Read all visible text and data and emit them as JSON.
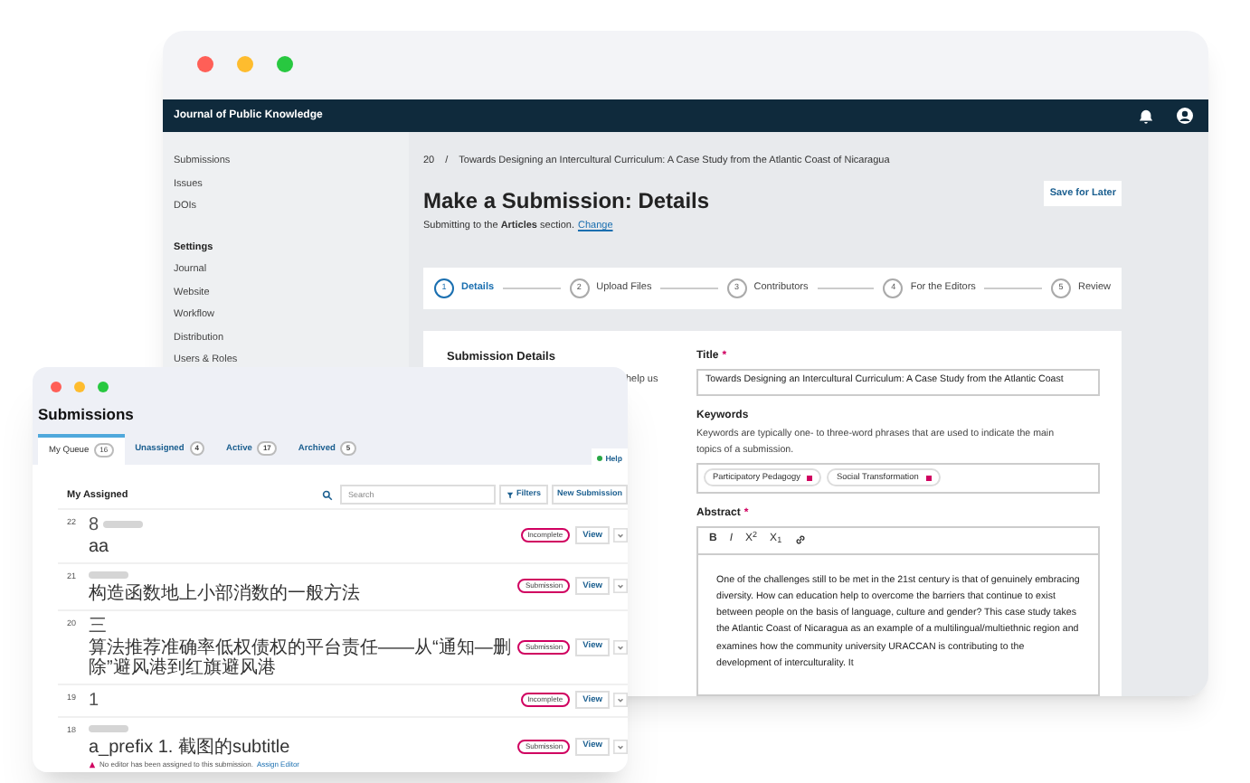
{
  "main_window": {
    "header": {
      "title": "Journal of Public Knowledge"
    },
    "sidebar": {
      "items": [
        {
          "label": "Submissions",
          "kind": "link"
        },
        {
          "label": "Issues",
          "kind": "link"
        },
        {
          "label": "DOIs",
          "kind": "link"
        },
        {
          "label": "Settings",
          "kind": "heading"
        },
        {
          "label": "Journal",
          "kind": "link"
        },
        {
          "label": "Website",
          "kind": "link"
        },
        {
          "label": "Workflow",
          "kind": "link"
        },
        {
          "label": "Distribution",
          "kind": "link"
        },
        {
          "label": "Users & Roles",
          "kind": "link"
        }
      ]
    },
    "breadcrumb": {
      "number": "20",
      "separator": "/",
      "title": "Towards Designing an Intercultural Curriculum: A Case Study from the Atlantic Coast of Nicaragua"
    },
    "page_title": "Make a Submission: Details",
    "subtitle": "Submitting to the **Articles** section.",
    "change_link": "Change",
    "save_button": "Save for Later",
    "steps": [
      {
        "number": "1",
        "label": "Details",
        "selected": true
      },
      {
        "number": "2",
        "label": "Upload Files",
        "selected": false
      },
      {
        "number": "3",
        "label": "Contributors",
        "selected": false
      },
      {
        "number": "4",
        "label": "For the Editors",
        "selected": false
      },
      {
        "number": "5",
        "label": "Review",
        "selected": false
      }
    ],
    "section": {
      "title": "Submission Details",
      "description_fragment": "help us"
    },
    "form": {
      "required_mark": "*",
      "title_label": "Title",
      "title_value": "Towards Designing an Intercultural Curriculum: A Case Study from the Atlantic Coast",
      "keywords_label": "Keywords",
      "keywords_help": "Keywords are typically one- to three-word phrases that are used to indicate the main topics of a submission.",
      "keywords": [
        "Participatory Pedagogy",
        "Social Transformation"
      ],
      "abstract_label": "Abstract",
      "toolbar": [
        "B",
        "I",
        "X$^{2}$",
        "X$_{1}$"
      ],
      "abstract": "One of the challenges still to be met in the 21st century is that of genuinely embracing diversity. How can education help to overcome the barriers that continue to exist between people on the basis of language, culture and gender? This case study takes the Atlantic Coast of Nicaragua as an example of a multilingual/multiethnic region and examines how the community university URACCAN is contributing to the development of interculturality. It"
    }
  },
  "submissions_window": {
    "title": "Submissions",
    "tabs": [
      {
        "label": "My Queue",
        "count": "16",
        "selected": true
      },
      {
        "label": "Unassigned",
        "count": "4",
        "selected": false
      },
      {
        "label": "Active",
        "count": "17",
        "selected": false
      },
      {
        "label": "Archived",
        "count": "5",
        "selected": false
      }
    ],
    "help_button": "Help",
    "list_title": "My Assigned",
    "search_placeholder": "Search",
    "filters_button": "Filters",
    "new_button": "New Submission",
    "rows": [
      {
        "id": "22",
        "author": "8",
        "redacted": true,
        "title": "aa",
        "stage": "Incomplete",
        "view": "View"
      },
      {
        "id": "21",
        "redacted": true,
        "title": "构造函数地上小部消数的一般方法",
        "stage": "Submission",
        "view": "View"
      },
      {
        "id": "20",
        "author": "三",
        "redacted": false,
        "title": "算法推荐准确率低权债权的平台责任——从“通知—删除”避风港到红旗避风港",
        "stage": "Submission",
        "view": "View"
      },
      {
        "id": "19",
        "author": "1",
        "redacted": false,
        "stage": "Incomplete",
        "view": "View"
      },
      {
        "id": "18",
        "redacted": true,
        "title": "a_prefix 1. 截图的subtitle",
        "stage": "Submission",
        "view": "View",
        "warning": "No editor has been assigned to this submission.",
        "warning_link": "Assign Editor"
      }
    ]
  }
}
